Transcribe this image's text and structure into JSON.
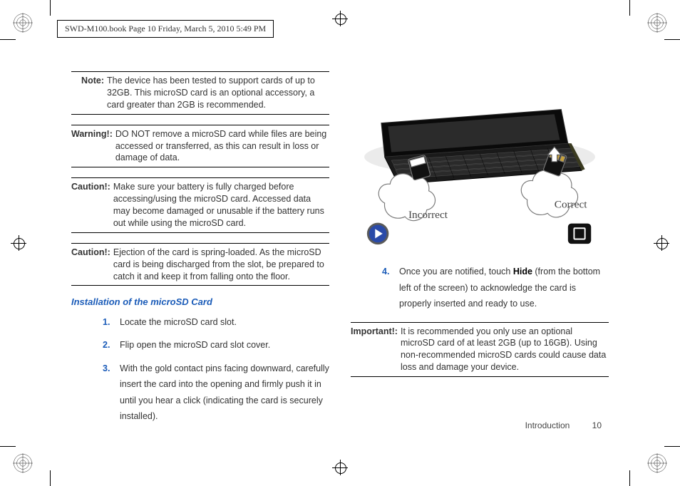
{
  "header": {
    "text": "SWD-M100.book  Page 10  Friday, March 5, 2010  5:49 PM"
  },
  "left": {
    "note": {
      "label": "Note:",
      "text": "The device has been tested to support cards of up to 32GB. This microSD card is an optional accessory, a card greater than 2GB is recommended."
    },
    "warning": {
      "label": "Warning!:",
      "text": "DO NOT remove a microSD card while files are being accessed or transferred, as this can result in loss or damage of data."
    },
    "caution1": {
      "label": "Caution!:",
      "text": "Make sure your battery is fully charged before accessing/using the microSD card. Accessed data may become damaged or unusable if the battery runs out while using the microSD card."
    },
    "caution2": {
      "label": "Caution!:",
      "text": "Ejection of the card is spring-loaded. As the microSD card is being discharged from the slot, be prepared to catch it and keep it from falling onto the floor."
    },
    "section_title": "Installation of the microSD Card",
    "steps": {
      "s1": {
        "num": "1.",
        "text": "Locate the microSD card slot."
      },
      "s2": {
        "num": "2.",
        "text": "Flip open the microSD card slot cover."
      },
      "s3": {
        "num": "3.",
        "text": "With the gold contact pins facing downward, carefully insert the card into the opening and firmly push it in until you hear a click (indicating the card is securely installed)."
      }
    }
  },
  "right": {
    "illust": {
      "incorrect": "Incorrect",
      "correct": "Correct"
    },
    "step4": {
      "num": "4.",
      "pre": "Once you are notified, touch ",
      "bold": "Hide",
      "post": " (from the bottom left of the screen) to acknowledge the card is properly inserted and ready to use."
    },
    "important": {
      "label": "Important!:",
      "text": "It is recommended you only use an optional microSD card of at least 2GB (up to 16GB). Using non-recommended microSD cards could cause data loss and damage your device."
    }
  },
  "footer": {
    "section": "Introduction",
    "page": "10"
  }
}
